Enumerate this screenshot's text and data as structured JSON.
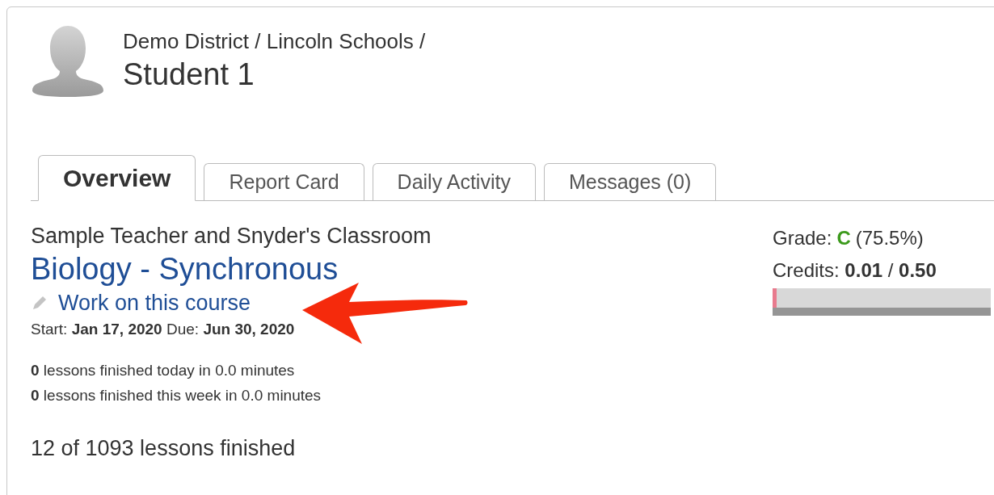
{
  "header": {
    "breadcrumb": "Demo District / Lincoln Schools /",
    "student_name": "Student 1"
  },
  "tabs": [
    {
      "label": "Overview",
      "selected": true
    },
    {
      "label": "Report Card",
      "selected": false
    },
    {
      "label": "Daily Activity",
      "selected": false
    },
    {
      "label": "Messages (0)",
      "selected": false
    }
  ],
  "course": {
    "classroom": "Sample Teacher and Snyder's Classroom",
    "title": "Biology - Synchronous",
    "work_link": "Work on this course",
    "dates": "Start: **Jan 17, 2020** Due: **Jun 30, 2020**",
    "activity": [
      "**0** lessons finished today in 0.0 minutes",
      "**0** lessons finished this week in 0.0 minutes"
    ],
    "progress": "12 of 1093 lessons finished"
  },
  "grade": {
    "label": "Grade:",
    "letter": "C",
    "percent": "(75.5%)",
    "credits": "Credits: **0.01** / **0.50**",
    "level": 0.02
  }
}
